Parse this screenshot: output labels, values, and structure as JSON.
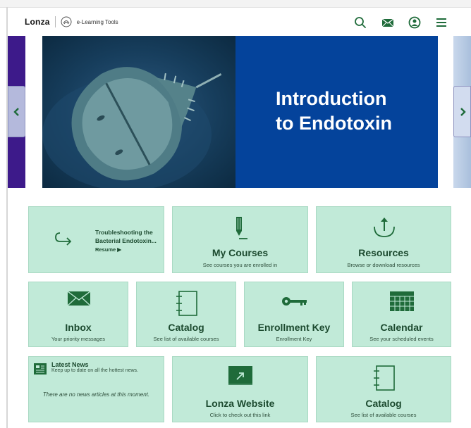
{
  "header": {
    "logo_text": "Lonza",
    "app_title": "e-Learning Tools",
    "icons": [
      "search-icon",
      "mail-icon",
      "user-icon",
      "menu-icon"
    ]
  },
  "carousel": {
    "slide_title_line1": "Introduction",
    "slide_title_line2": "to Endotoxin",
    "prev_icon": "chevron-left-icon",
    "next_icon": "chevron-right-icon"
  },
  "tiles": {
    "resume": {
      "title": "Troubleshooting the Bacterial Endotoxin...",
      "link_label": "Resume ▶",
      "icon": "redo-arrow-icon"
    },
    "my_courses": {
      "title": "My Courses",
      "subtitle": "See courses you are enrolled in",
      "icon": "pencil-icon"
    },
    "resources": {
      "title": "Resources",
      "subtitle": "Browse or download resources",
      "icon": "upload-icon"
    },
    "inbox": {
      "title": "Inbox",
      "subtitle": "Your priority messages",
      "icon": "envelope-icon"
    },
    "catalog": {
      "title": "Catalog",
      "subtitle": "See list of available courses",
      "icon": "notebook-icon"
    },
    "enrollment_key": {
      "title": "Enrollment Key",
      "subtitle": "Enrollment Key",
      "icon": "key-icon"
    },
    "calendar": {
      "title": "Calendar",
      "subtitle": "See your scheduled events",
      "icon": "calendar-icon"
    },
    "news": {
      "title": "Latest News",
      "subtitle": "Keep up to date on all the hottest news.",
      "empty_message": "There are no news articles at this moment.",
      "icon": "newspaper-icon"
    },
    "website": {
      "title": "Lonza Website",
      "subtitle": "Click to check out this link",
      "icon": "external-link-icon"
    },
    "catalog2": {
      "title": "Catalog",
      "subtitle": "See list of available courses",
      "icon": "notebook-icon"
    }
  },
  "colors": {
    "tile_bg": "#c1ead8",
    "tile_text": "#1c4a2f",
    "icon_green": "#1f6b3a",
    "slide_blue": "#04439b"
  }
}
